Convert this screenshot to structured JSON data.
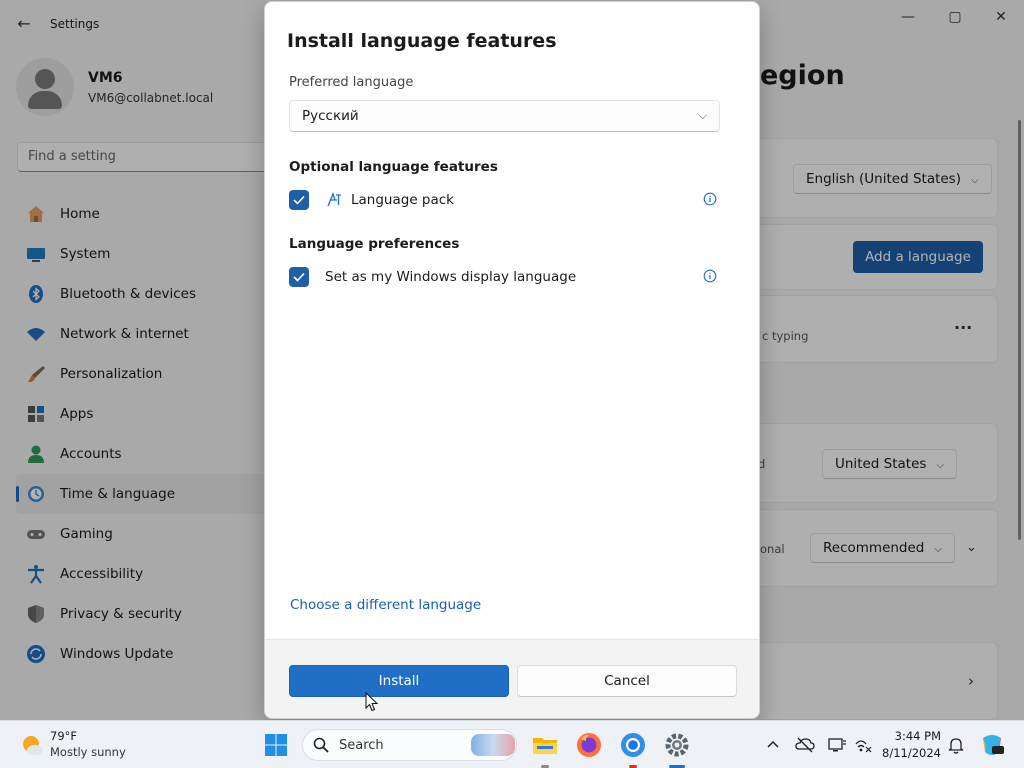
{
  "window": {
    "title": "Settings",
    "back": "←",
    "minimize": "—",
    "maximize": "▢",
    "close": "✕"
  },
  "user": {
    "name": "VM6",
    "email": "VM6@collabnet.local"
  },
  "search": {
    "placeholder": "Find a setting"
  },
  "nav": {
    "items": [
      {
        "label": "Home",
        "icon": "home-icon"
      },
      {
        "label": "System",
        "icon": "system-icon"
      },
      {
        "label": "Bluetooth & devices",
        "icon": "bluetooth-icon"
      },
      {
        "label": "Network & internet",
        "icon": "wifi-icon"
      },
      {
        "label": "Personalization",
        "icon": "brush-icon"
      },
      {
        "label": "Apps",
        "icon": "apps-icon"
      },
      {
        "label": "Accounts",
        "icon": "accounts-icon"
      },
      {
        "label": "Time & language",
        "icon": "time-language-icon",
        "active": true
      },
      {
        "label": "Gaming",
        "icon": "gamepad-icon"
      },
      {
        "label": "Accessibility",
        "icon": "accessibility-icon"
      },
      {
        "label": "Privacy & security",
        "icon": "shield-icon"
      },
      {
        "label": "Windows Update",
        "icon": "update-icon"
      }
    ]
  },
  "page": {
    "heading_fragment": "egion",
    "display_language": "English (United States)",
    "add_language": "Add a language",
    "typing_fragment": "c typing",
    "more": "···",
    "region_fragment": "d",
    "country": "United States",
    "format_fragment": "onal",
    "format": "Recommended"
  },
  "dialog": {
    "title": "Install language features",
    "preferred_label": "Preferred language",
    "preferred_value": "Русский",
    "optional_heading": "Optional language features",
    "language_pack": "Language pack",
    "preferences_heading": "Language preferences",
    "display_language_option": "Set as my Windows display language",
    "choose_link": "Choose a different language",
    "install": "Install",
    "cancel": "Cancel"
  },
  "taskbar": {
    "weather_temp": "79°F",
    "weather_condition": "Mostly sunny",
    "search": "Search",
    "time": "3:44 PM",
    "date": "8/11/2024"
  },
  "colors": {
    "accent": "#1f5fa8",
    "primary_button": "#1f6fc5",
    "link": "#1a5fb4"
  }
}
